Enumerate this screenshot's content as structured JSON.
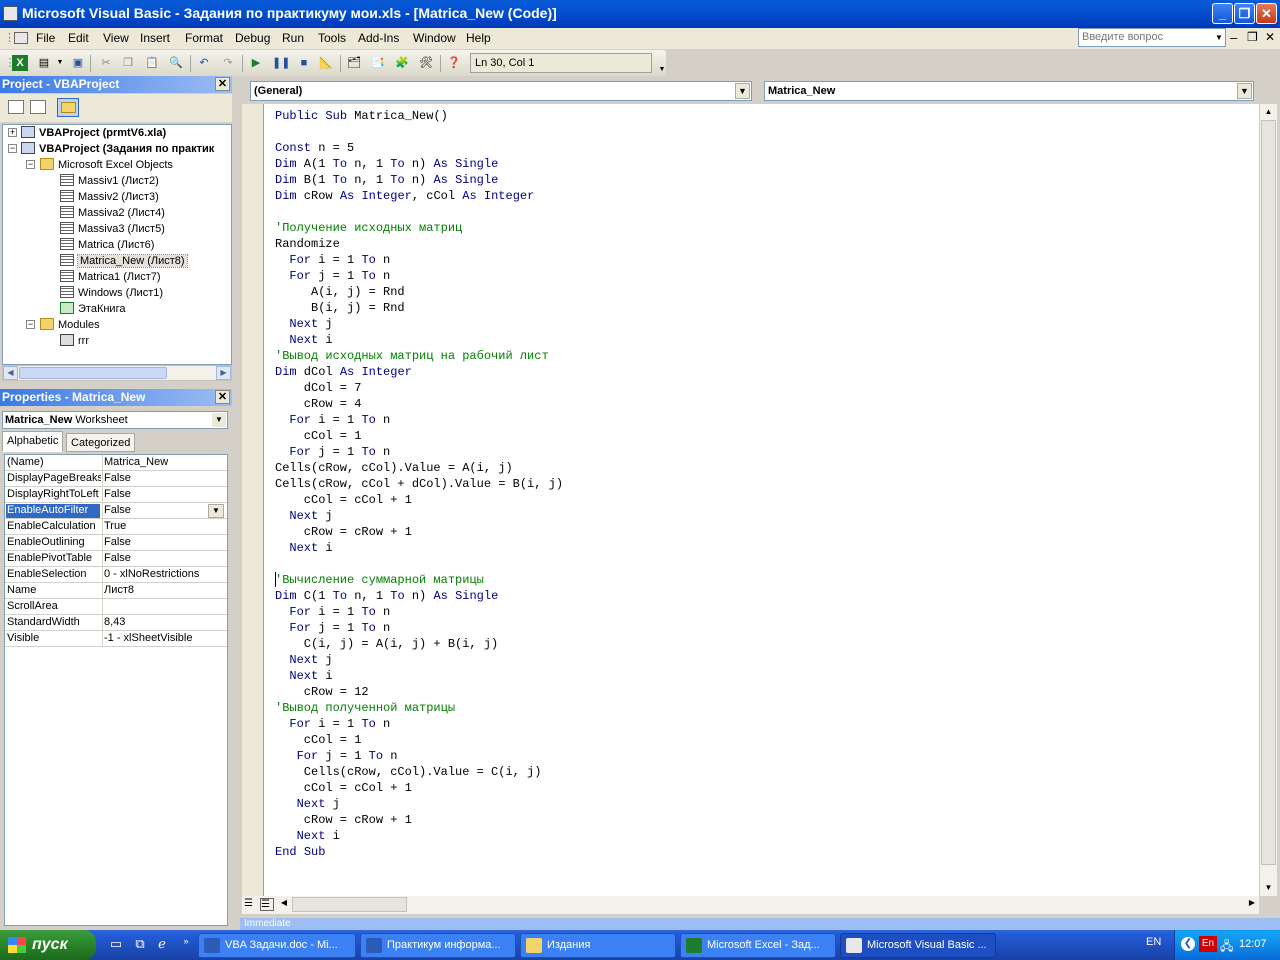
{
  "window": {
    "title": "Microsoft Visual Basic - Задания по практикуму мои.xls - [Matrica_New (Code)]"
  },
  "menu": [
    "File",
    "Edit",
    "View",
    "Insert",
    "Format",
    "Debug",
    "Run",
    "Tools",
    "Add-Ins",
    "Window",
    "Help"
  ],
  "ask": {
    "placeholder": "Введите вопрос"
  },
  "toolbar": {
    "position": "Ln 30, Col 1"
  },
  "project": {
    "title": "Project - VBAProject",
    "nodes": [
      {
        "label": "VBAProject (prmtV6.xla)",
        "icon": "vba-project-icon",
        "bold": true
      },
      {
        "label": "VBAProject (Задания по практик",
        "icon": "vba-project-icon",
        "bold": true
      },
      {
        "label": "Microsoft Excel Objects",
        "icon": "folder-icon"
      },
      {
        "label": "Massiv1 (Лист2)",
        "icon": "worksheet-icon"
      },
      {
        "label": "Massiv2 (Лист3)",
        "icon": "worksheet-icon"
      },
      {
        "label": "Massiva2 (Лист4)",
        "icon": "worksheet-icon"
      },
      {
        "label": "Massiva3 (Лист5)",
        "icon": "worksheet-icon"
      },
      {
        "label": "Matrica (Лист6)",
        "icon": "worksheet-icon"
      },
      {
        "label": "Matrica_New (Лист8)",
        "icon": "worksheet-icon",
        "selected": true
      },
      {
        "label": "Matrica1 (Лист7)",
        "icon": "worksheet-icon"
      },
      {
        "label": "Windows (Лист1)",
        "icon": "worksheet-icon"
      },
      {
        "label": "ЭтаКнига",
        "icon": "workbook-icon"
      },
      {
        "label": "Modules",
        "icon": "folder-icon"
      },
      {
        "label": "rrr",
        "icon": "module-icon"
      }
    ]
  },
  "properties": {
    "title": "Properties - Matrica_New",
    "object_name": "Matrica_New",
    "object_type": "Worksheet",
    "tabs": [
      "Alphabetic",
      "Categorized"
    ],
    "rows": [
      {
        "name": "(Name)",
        "value": "Matrica_New"
      },
      {
        "name": "DisplayPageBreaks",
        "value": "False"
      },
      {
        "name": "DisplayRightToLeft",
        "value": "False"
      },
      {
        "name": "EnableAutoFilter",
        "value": "False",
        "selected": true
      },
      {
        "name": "EnableCalculation",
        "value": "True"
      },
      {
        "name": "EnableOutlining",
        "value": "False"
      },
      {
        "name": "EnablePivotTable",
        "value": "False"
      },
      {
        "name": "EnableSelection",
        "value": "0 - xlNoRestrictions"
      },
      {
        "name": "Name",
        "value": "Лист8"
      },
      {
        "name": "ScrollArea",
        "value": ""
      },
      {
        "name": "StandardWidth",
        "value": "8,43"
      },
      {
        "name": "Visible",
        "value": "-1 - xlSheetVisible"
      }
    ]
  },
  "code": {
    "object_combo": "(General)",
    "proc_combo": "Matrica_New",
    "lines": [
      "Public Sub Matrica_New()",
      "",
      "Const n = 5",
      "Dim A(1 To n, 1 To n) As Single",
      "Dim B(1 To n, 1 To n) As Single",
      "Dim cRow As Integer, cCol As Integer",
      "",
      "'Получение исходных матриц",
      "Randomize",
      "  For i = 1 To n",
      "  For j = 1 To n",
      "     A(i, j) = Rnd",
      "     B(i, j) = Rnd",
      "  Next j",
      "  Next i",
      "'Вывод исходных матриц на рабочий лист",
      "Dim dCol As Integer",
      "    dCol = 7",
      "    cRow = 4",
      "  For i = 1 To n",
      "    cCol = 1",
      "  For j = 1 To n",
      "Cells(cRow, cCol).Value = A(i, j)",
      "Cells(cRow, cCol + dCol).Value = B(i, j)",
      "    cCol = cCol + 1",
      "  Next j",
      "    cRow = cRow + 1",
      "  Next i",
      "",
      "'Вычисление суммарной матрицы",
      "Dim C(1 To n, 1 To n) As Single",
      "  For i = 1 To n",
      "  For j = 1 To n",
      "    C(i, j) = A(i, j) + B(i, j)",
      "  Next j",
      "  Next i",
      "    cRow = 12",
      "'Вывод полученной матрицы",
      "  For i = 1 To n",
      "    cCol = 1",
      "   For j = 1 To n",
      "    Cells(cRow, cCol).Value = C(i, j)",
      "    cCol = cCol + 1",
      "   Next j",
      "    cRow = cRow + 1",
      "   Next i",
      "End Sub"
    ]
  },
  "immediate": {
    "title": "Immediate"
  },
  "taskbar": {
    "start": "пуск",
    "tasks": [
      {
        "label": "VBA Задачи.doc - Mi...",
        "icon": "word-icon"
      },
      {
        "label": "Практикум информа...",
        "icon": "word-icon"
      },
      {
        "label": "Издания",
        "icon": "folder-icon"
      },
      {
        "label": "Microsoft Excel - Зад...",
        "icon": "excel-icon"
      },
      {
        "label": "Microsoft Visual Basic ...",
        "icon": "vba-icon",
        "active": true
      }
    ],
    "lang": "EN",
    "tray_lang": "En",
    "clock": "12:07"
  },
  "colors": {
    "keyword": "#00007f",
    "comment": "#007f00",
    "selection": "#316ac5"
  }
}
